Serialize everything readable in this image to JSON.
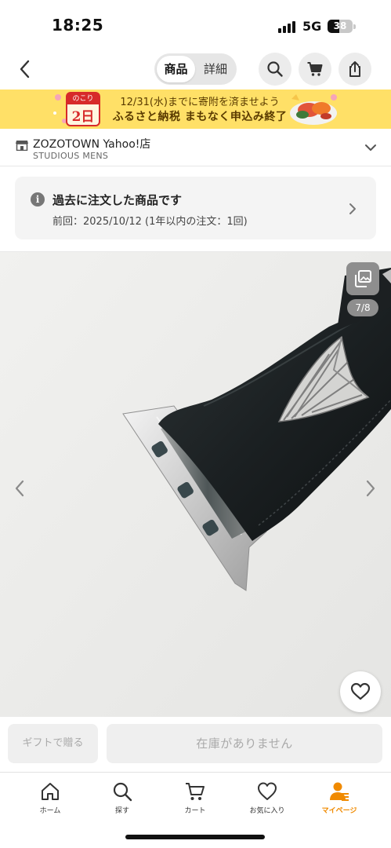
{
  "status_bar": {
    "time": "18:25",
    "network": "5G",
    "battery": "38",
    "battery_level": 0.38
  },
  "header": {
    "segments": [
      {
        "label": "商品",
        "active": true
      },
      {
        "label": "詳細",
        "active": false
      }
    ],
    "icons": [
      "back-icon",
      "search-icon",
      "cart-icon",
      "share-icon"
    ]
  },
  "banner": {
    "badge_top": "のこり",
    "badge_main": "2日",
    "line1": "12/31(水)までに寄附を済ませよう",
    "line2": "ふるさと納税 まもなく申込み終了",
    "accent": "#d72a2a",
    "background": "#ffe067"
  },
  "store": {
    "name": "ZOZOTOWN Yahoo!店",
    "brand": "STUDIOUS MENS"
  },
  "order_history": {
    "title": "過去に注文した商品です",
    "detail": "前回：2025/10/12 (1年以内の注文：1回)"
  },
  "gallery": {
    "counter": "7/8",
    "current": 7,
    "total": 8
  },
  "actions": {
    "gift": "ギフトで贈る",
    "stock": "在庫がありません"
  },
  "tabbar": {
    "active_color": "#f08a00",
    "items": [
      {
        "label": "ホーム",
        "icon": "home-icon"
      },
      {
        "label": "探す",
        "icon": "search-icon"
      },
      {
        "label": "カート",
        "icon": "cart-icon"
      },
      {
        "label": "お気に入り",
        "icon": "heart-icon"
      },
      {
        "label": "マイページ",
        "icon": "user-icon",
        "active": true
      }
    ]
  }
}
